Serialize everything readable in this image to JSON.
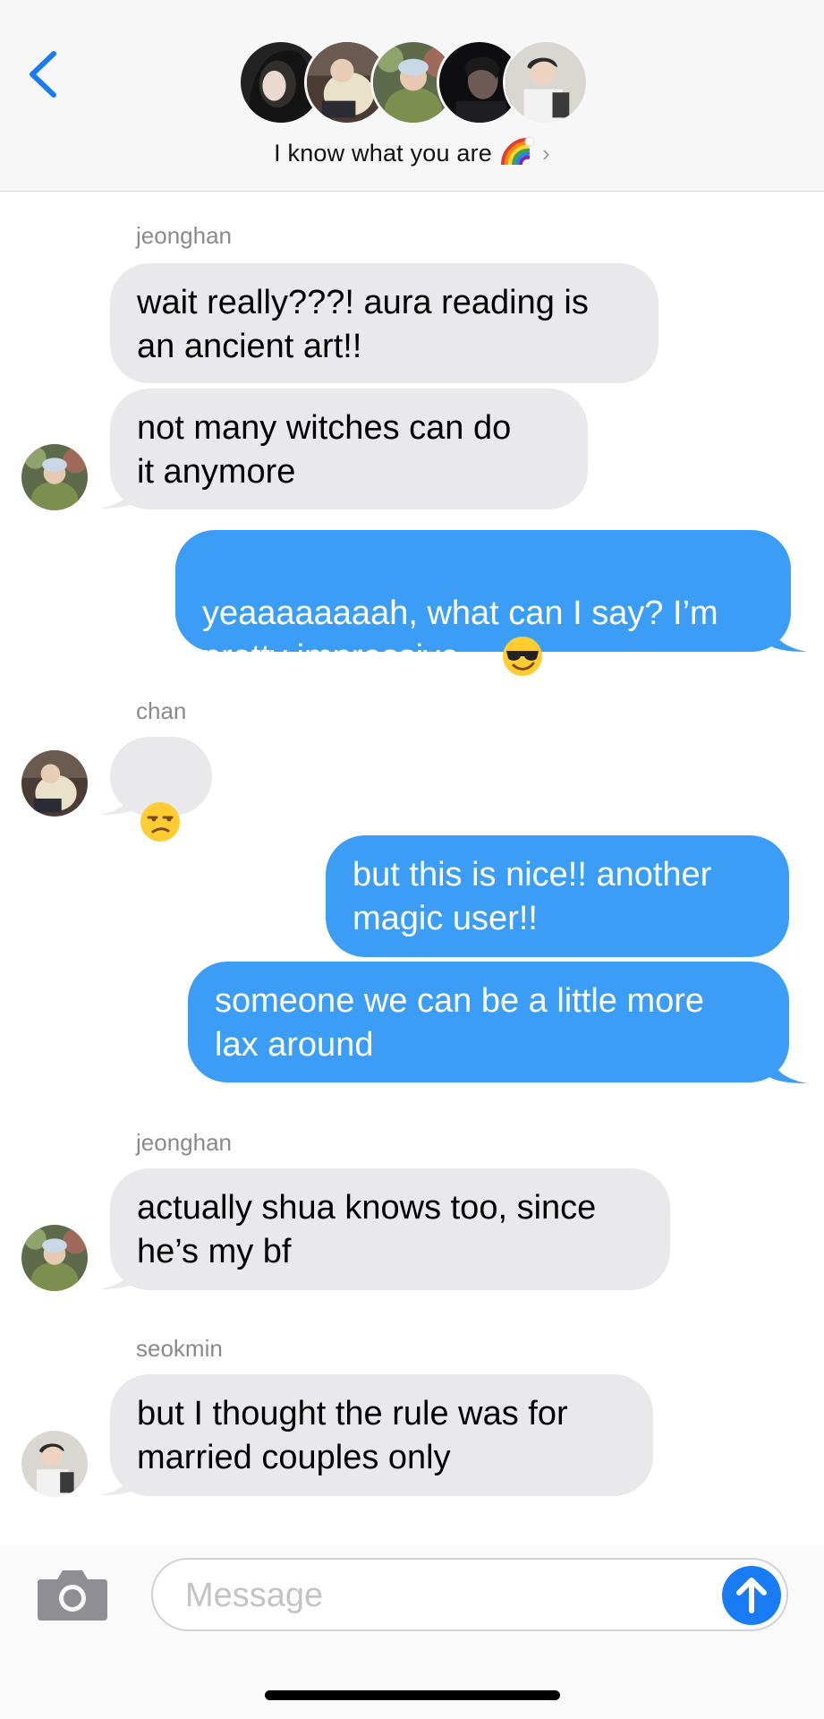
{
  "header": {
    "back_icon": "chevron-left-icon",
    "group_name": "I know what you are",
    "group_emoji": "rainbow",
    "chevron": "›",
    "avatars": [
      "member-1",
      "member-2",
      "member-3",
      "member-4",
      "member-5"
    ]
  },
  "messages": [
    {
      "sender": "jeonghan",
      "direction": "incoming",
      "texts": [
        "wait really???! aura reading is\nan ancient art!!",
        "not many witches can do\nit anymore"
      ]
    },
    {
      "sender": "me",
      "direction": "outgoing",
      "texts": [
        "yeaaaaaaaah, what can I say? I’m\npretty impressive"
      ],
      "emoji": "smiling-face-with-sunglasses"
    },
    {
      "sender": "chan",
      "direction": "incoming",
      "emoji": "unamused-face"
    },
    {
      "sender": "me",
      "direction": "outgoing",
      "texts": [
        "but this is nice!! another\nmagic user!!",
        "someone we can be a little more\nlax around"
      ]
    },
    {
      "sender": "jeonghan",
      "direction": "incoming",
      "texts": [
        "actually shua knows too, since\nhe’s my bf"
      ]
    },
    {
      "sender": "seokmin",
      "direction": "incoming",
      "texts": [
        "but I thought the rule was for\nmarried couples only"
      ]
    }
  ],
  "composer": {
    "camera_icon": "camera-icon",
    "placeholder": "Message",
    "send_icon": "arrow-up-icon"
  },
  "colors": {
    "outgoing_bubble": "#3b9df5",
    "incoming_bubble": "#e9e9eb",
    "accent": "#1a7cf5"
  }
}
